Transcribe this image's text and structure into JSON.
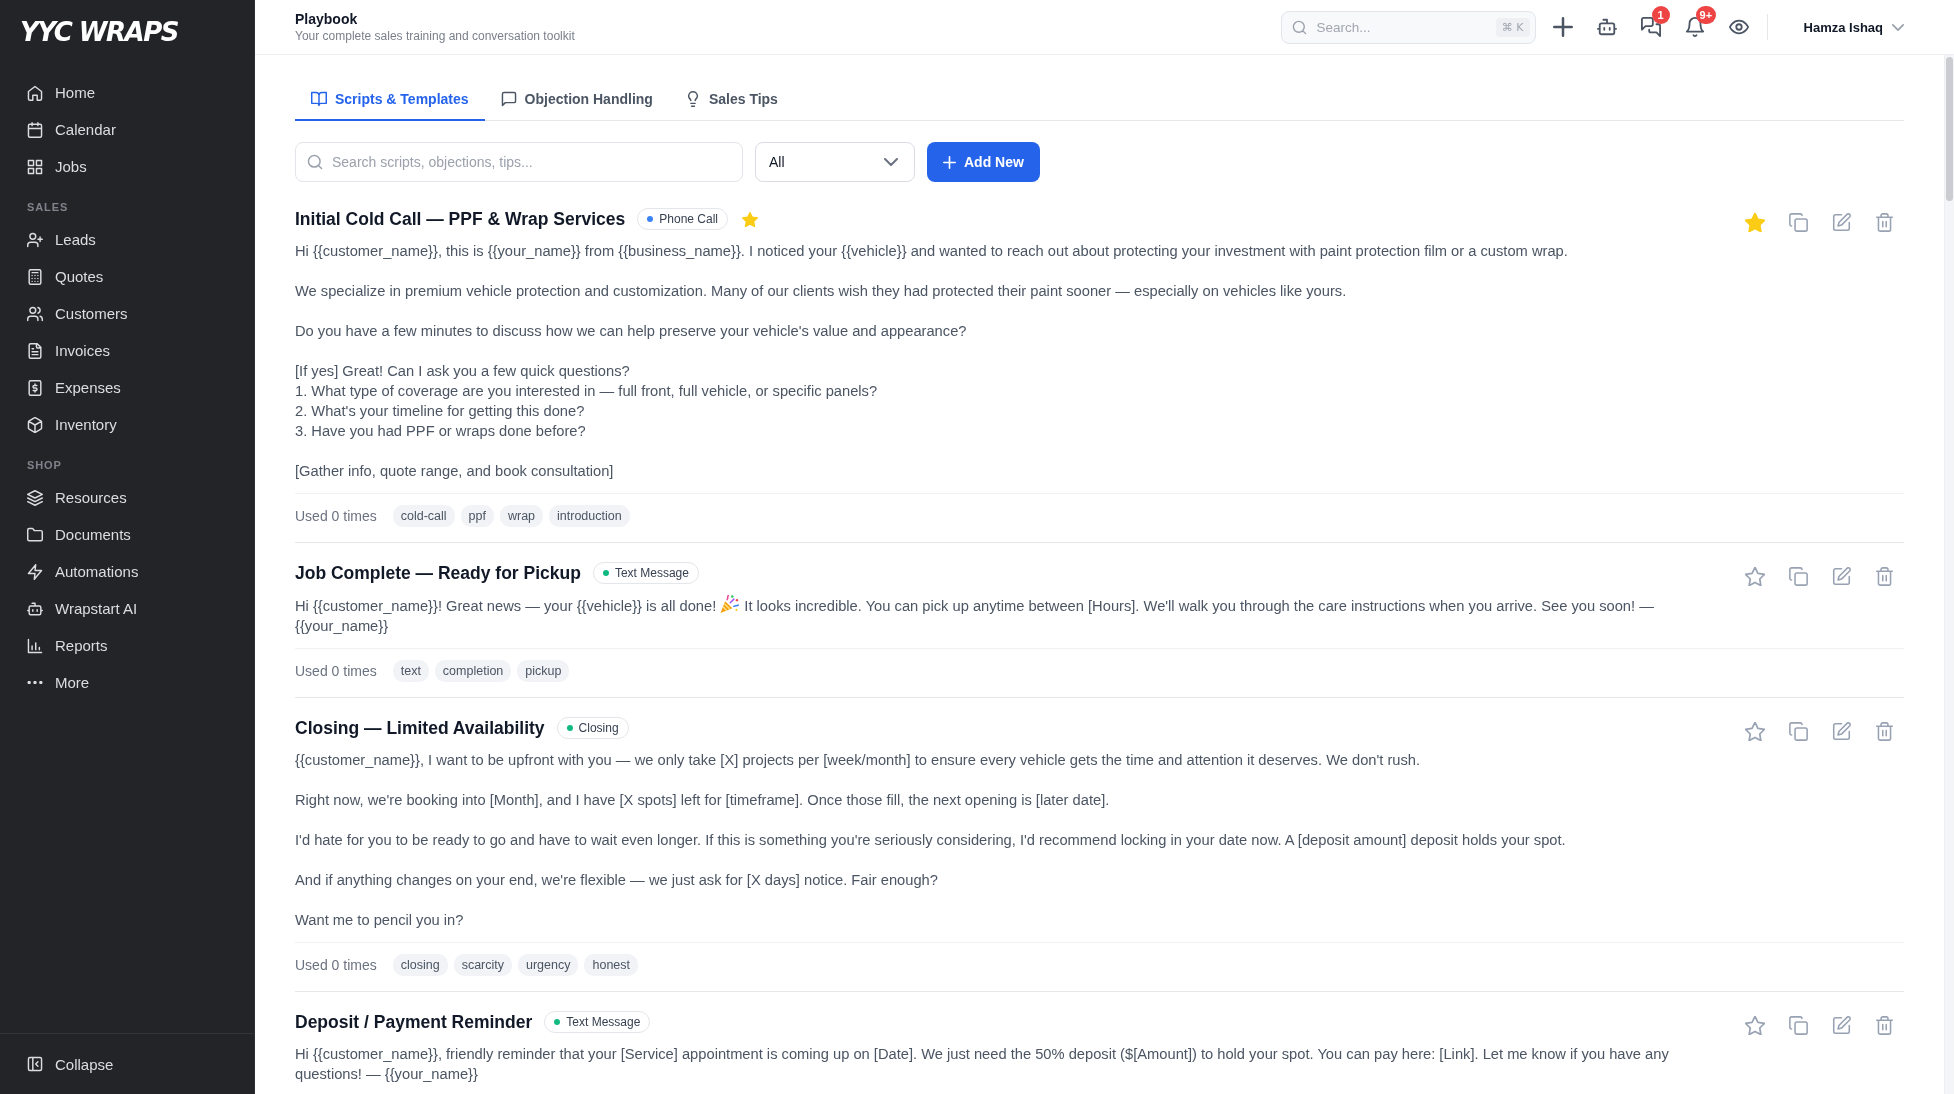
{
  "sidebar": {
    "logo": "YYC WRAPS",
    "groups": [
      {
        "items": [
          {
            "label": "Home",
            "selected": false
          },
          {
            "label": "Calendar",
            "selected": false
          },
          {
            "label": "Jobs",
            "selected": false
          }
        ]
      },
      {
        "label": "SALES",
        "items": [
          {
            "label": "Leads",
            "selected": false
          },
          {
            "label": "Quotes",
            "selected": false
          },
          {
            "label": "Customers",
            "selected": false
          },
          {
            "label": "Invoices",
            "selected": false
          },
          {
            "label": "Expenses",
            "selected": false
          },
          {
            "label": "Inventory",
            "selected": false
          }
        ]
      },
      {
        "label": "SHOP",
        "items": [
          {
            "label": "Resources",
            "selected": false
          },
          {
            "label": "Documents",
            "selected": false
          },
          {
            "label": "Automations",
            "selected": false
          },
          {
            "label": "Wrapstart AI",
            "selected": false
          },
          {
            "label": "Reports",
            "selected": false
          },
          {
            "label": "More",
            "selected": false
          }
        ]
      }
    ],
    "collapse": "Collapse"
  },
  "header": {
    "title": "Playbook",
    "subtitle": "Your complete sales training and conversation toolkit",
    "search": {
      "placeholder": "Search...",
      "shortcut": "⌘ K"
    },
    "chat_count": "1",
    "notification_count": "9+",
    "user": "Hamza Ishaq"
  },
  "tabs": [
    {
      "label": "Scripts & Templates",
      "selected": true
    },
    {
      "label": "Objection Handling",
      "selected": false
    },
    {
      "label": "Sales Tips",
      "selected": false
    }
  ],
  "toolbar": {
    "search": {
      "placeholder": "Search scripts, objections, tips..."
    },
    "filter": "All",
    "add_button": "Add New"
  },
  "cards": [
    {
      "title": "Initial Cold Call — PPF & Wrap Services",
      "badge": {
        "label": "Phone Call",
        "color": "#3b82f6"
      },
      "starred": true,
      "body": [
        {
          "kind": "text",
          "text": "Hi {{customer_name}}, this is {{your_name}} from {{business_name}}. I noticed your {{vehicle}} and wanted to reach out about protecting your investment with paint protection film or a custom wrap."
        },
        {
          "kind": "text",
          "text": "We specialize in premium vehicle protection and customization. Many of our clients wish they had protected their paint sooner — especially on vehicles like yours."
        },
        {
          "kind": "text",
          "text": "Do you have a few minutes to discuss how we can help preserve your vehicle's value and appearance?"
        },
        {
          "kind": "text",
          "text": "[If yes] Great! Can I ask you a few quick questions?\n1. What type of coverage are you interested in — full front, full vehicle, or specific panels?\n2. What's your timeline for getting this done?\n3. Have you had PPF or wraps done before?"
        },
        {
          "kind": "text",
          "text": "[Gather info, quote range, and book consultation]"
        }
      ],
      "usage": "Used 0 times",
      "tags": [
        "cold-call",
        "ppf",
        "wrap",
        "introduction"
      ]
    },
    {
      "title": "Job Complete — Ready for Pickup",
      "badge": {
        "label": "Text Message",
        "color": "#10b981"
      },
      "starred": false,
      "body": [
        {
          "kind": "text_with_icon",
          "before": "Hi {{customer_name}}! Great news — your {{vehicle}} is all done!",
          "after": "It looks incredible. You can pick up anytime between [Hours]. We'll walk you through the care instructions when you arrive. See you soon! — {{your_name}}"
        }
      ],
      "usage": "Used 0 times",
      "tags": [
        "text",
        "completion",
        "pickup"
      ]
    },
    {
      "title": "Closing — Limited Availability",
      "badge": {
        "label": "Closing",
        "color": "#10b981"
      },
      "starred": false,
      "body": [
        {
          "kind": "text",
          "text": "{{customer_name}}, I want to be upfront with you — we only take [X] projects per [week/month] to ensure every vehicle gets the time and attention it deserves. We don't rush."
        },
        {
          "kind": "text",
          "text": "Right now, we're booking into [Month], and I have [X spots] left for [timeframe]. Once those fill, the next opening is [later date]."
        },
        {
          "kind": "text",
          "text": "I'd hate for you to be ready to go and have to wait even longer. If this is something you're seriously considering, I'd recommend locking in your date now. A [deposit amount] deposit holds your spot."
        },
        {
          "kind": "text",
          "text": "And if anything changes on your end, we're flexible — we just ask for [X days] notice. Fair enough?"
        },
        {
          "kind": "text",
          "text": "Want me to pencil you in?"
        }
      ],
      "usage": "Used 0 times",
      "tags": [
        "closing",
        "scarcity",
        "urgency",
        "honest"
      ]
    },
    {
      "title": "Deposit / Payment Reminder",
      "badge": {
        "label": "Text Message",
        "color": "#10b981"
      },
      "starred": false,
      "body": [
        {
          "kind": "text",
          "text": "Hi {{customer_name}}, friendly reminder that your [Service] appointment is coming up on [Date]. We just need the 50% deposit ($[Amount]) to hold your spot. You can pay here: [Link]. Let me know if you have any questions! — {{your_name}}"
        }
      ]
    }
  ]
}
